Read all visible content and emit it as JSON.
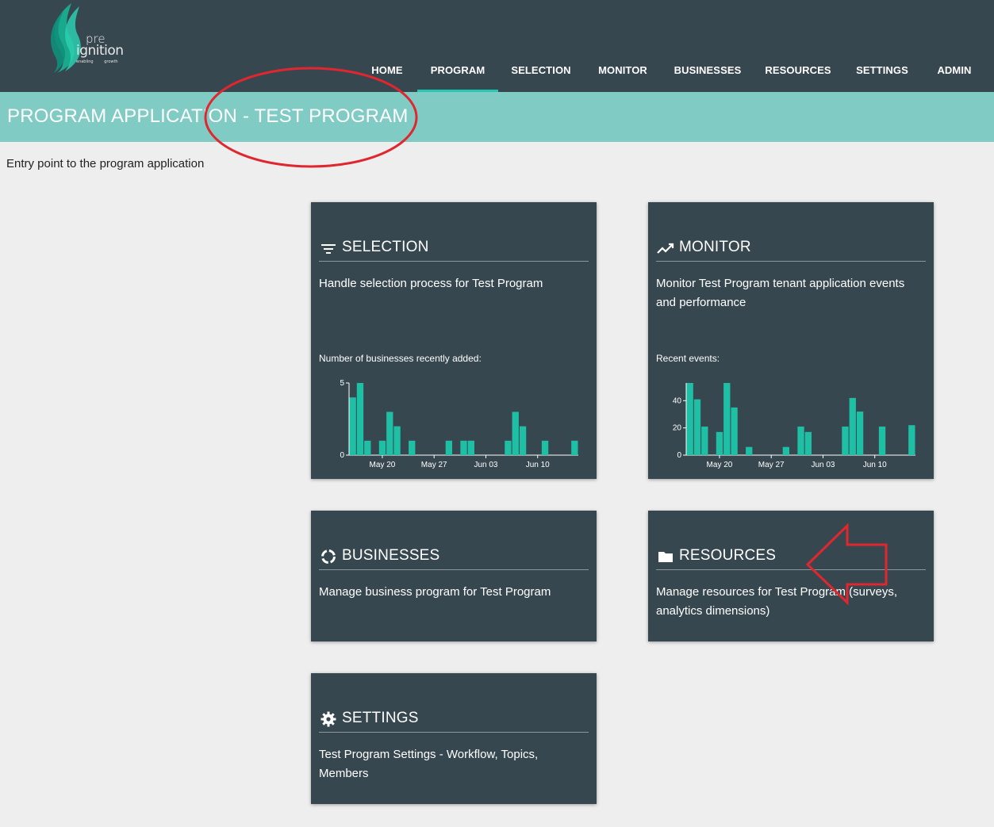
{
  "logo": {
    "pre": "pre",
    "name": "ignition",
    "tagline": "enabling growth"
  },
  "nav": [
    {
      "label": "HOME",
      "active": false
    },
    {
      "label": "PROGRAM",
      "active": true
    },
    {
      "label": "SELECTION",
      "active": false
    },
    {
      "label": "MONITOR",
      "active": false
    },
    {
      "label": "BUSINESSES",
      "active": false
    },
    {
      "label": "RESOURCES",
      "active": false
    },
    {
      "label": "SETTINGS",
      "active": false
    },
    {
      "label": "ADMIN",
      "active": false
    }
  ],
  "page": {
    "title": "PROGRAM APPLICATION - TEST PROGRAM",
    "subtitle": "Entry point to the program application"
  },
  "cards": {
    "selection": {
      "icon": "filter-icon",
      "title": "SELECTION",
      "description": "Handle selection process for Test Program",
      "chart_label": "Number of businesses recently added:"
    },
    "monitor": {
      "icon": "trending-icon",
      "title": "MONITOR",
      "description": "Monitor Test Program tenant application events and performance",
      "chart_label": "Recent events:"
    },
    "businesses": {
      "icon": "loading-circle-icon",
      "title": "BUSINESSES",
      "description": "Manage business program for Test Program"
    },
    "resources": {
      "icon": "folder-icon",
      "title": "RESOURCES",
      "description": "Manage resources for Test Program (surveys, analytics dimensions)"
    },
    "settings": {
      "icon": "gear-icon",
      "title": "SETTINGS",
      "description": "Test Program Settings - Workflow, Topics, Members"
    }
  },
  "colors": {
    "header": "#37474f",
    "accent": "#80cbc4",
    "bar": "#1ebfa5",
    "annotation": "#e0262e"
  },
  "chart_data": [
    {
      "type": "bar",
      "ylim": [
        0,
        5
      ],
      "yticks": [
        0,
        5
      ],
      "xticks": [
        "May 20",
        "May 27",
        "Jun 03",
        "Jun 10"
      ],
      "x": [
        "May 16",
        "May 17",
        "May 18",
        "May 19",
        "May 20",
        "May 21",
        "May 22",
        "May 23",
        "May 24",
        "May 25",
        "May 26",
        "May 27",
        "May 28",
        "May 29",
        "May 30",
        "May 31",
        "Jun 01",
        "Jun 02",
        "Jun 03",
        "Jun 04",
        "Jun 05",
        "Jun 06",
        "Jun 07",
        "Jun 08",
        "Jun 09",
        "Jun 10",
        "Jun 11",
        "Jun 12",
        "Jun 13",
        "Jun 14",
        "Jun 15"
      ],
      "values": [
        4,
        5,
        1,
        0,
        1,
        3,
        2,
        0,
        1,
        0,
        0,
        0,
        0,
        1,
        0,
        1,
        1,
        0,
        0,
        0,
        0,
        1,
        3,
        2,
        0,
        0,
        1,
        0,
        0,
        0,
        1
      ]
    },
    {
      "type": "bar",
      "ylim": [
        0,
        53
      ],
      "yticks": [
        0,
        20,
        40
      ],
      "xticks": [
        "May 20",
        "May 27",
        "Jun 03",
        "Jun 10"
      ],
      "x": [
        "May 16",
        "May 17",
        "May 18",
        "May 19",
        "May 20",
        "May 21",
        "May 22",
        "May 23",
        "May 24",
        "May 25",
        "May 26",
        "May 27",
        "May 28",
        "May 29",
        "May 30",
        "May 31",
        "Jun 01",
        "Jun 02",
        "Jun 03",
        "Jun 04",
        "Jun 05",
        "Jun 06",
        "Jun 07",
        "Jun 08",
        "Jun 09",
        "Jun 10",
        "Jun 11",
        "Jun 12",
        "Jun 13",
        "Jun 14",
        "Jun 15"
      ],
      "values": [
        53,
        41,
        21,
        0,
        17,
        53,
        35,
        0,
        6,
        0,
        0,
        0,
        0,
        6,
        0,
        21,
        17,
        0,
        0,
        0,
        0,
        21,
        42,
        32,
        0,
        0,
        21,
        0,
        0,
        0,
        22
      ]
    }
  ]
}
